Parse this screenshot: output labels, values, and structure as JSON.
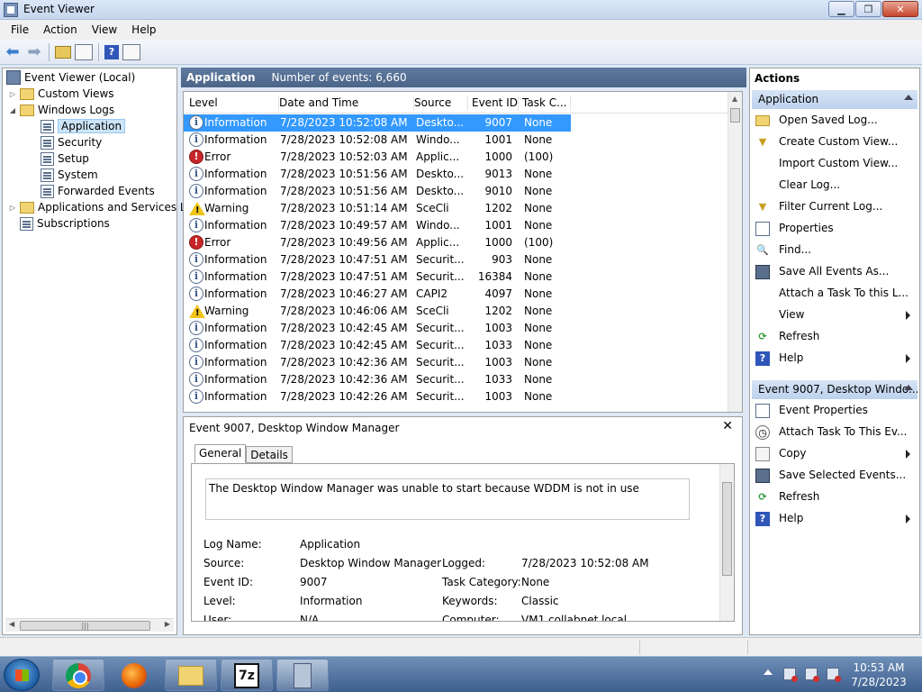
{
  "window": {
    "title": "Event Viewer"
  },
  "menu": [
    "File",
    "Action",
    "View",
    "Help"
  ],
  "tree": {
    "root": "Event Viewer (Local)",
    "custom_views": "Custom Views",
    "windows_logs": "Windows Logs",
    "logs": [
      "Application",
      "Security",
      "Setup",
      "System",
      "Forwarded Events"
    ],
    "apps_services": "Applications and Services Lo",
    "subscriptions": "Subscriptions"
  },
  "center": {
    "title": "Application",
    "count": "Number of events: 6,660"
  },
  "columns": [
    "Level",
    "Date and Time",
    "Source",
    "Event ID",
    "Task C..."
  ],
  "events": [
    {
      "level": "Information",
      "icon": "information",
      "date": "7/28/2023 10:52:08 AM",
      "source": "Deskto...",
      "id": "9007",
      "task": "None"
    },
    {
      "level": "Information",
      "icon": "information",
      "date": "7/28/2023 10:52:08 AM",
      "source": "Windo...",
      "id": "1001",
      "task": "None"
    },
    {
      "level": "Error",
      "icon": "error",
      "date": "7/28/2023 10:52:03 AM",
      "source": "Applic...",
      "id": "1000",
      "task": "(100)"
    },
    {
      "level": "Information",
      "icon": "information",
      "date": "7/28/2023 10:51:56 AM",
      "source": "Deskto...",
      "id": "9013",
      "task": "None"
    },
    {
      "level": "Information",
      "icon": "information",
      "date": "7/28/2023 10:51:56 AM",
      "source": "Deskto...",
      "id": "9010",
      "task": "None"
    },
    {
      "level": "Warning",
      "icon": "warning",
      "date": "7/28/2023 10:51:14 AM",
      "source": "SceCli",
      "id": "1202",
      "task": "None"
    },
    {
      "level": "Information",
      "icon": "information",
      "date": "7/28/2023 10:49:57 AM",
      "source": "Windo...",
      "id": "1001",
      "task": "None"
    },
    {
      "level": "Error",
      "icon": "error",
      "date": "7/28/2023 10:49:56 AM",
      "source": "Applic...",
      "id": "1000",
      "task": "(100)"
    },
    {
      "level": "Information",
      "icon": "information",
      "date": "7/28/2023 10:47:51 AM",
      "source": "Securit...",
      "id": "903",
      "task": "None"
    },
    {
      "level": "Information",
      "icon": "information",
      "date": "7/28/2023 10:47:51 AM",
      "source": "Securit...",
      "id": "16384",
      "task": "None"
    },
    {
      "level": "Information",
      "icon": "information",
      "date": "7/28/2023 10:46:27 AM",
      "source": "CAPI2",
      "id": "4097",
      "task": "None"
    },
    {
      "level": "Warning",
      "icon": "warning",
      "date": "7/28/2023 10:46:06 AM",
      "source": "SceCli",
      "id": "1202",
      "task": "None"
    },
    {
      "level": "Information",
      "icon": "information",
      "date": "7/28/2023 10:42:45 AM",
      "source": "Securit...",
      "id": "1003",
      "task": "None"
    },
    {
      "level": "Information",
      "icon": "information",
      "date": "7/28/2023 10:42:45 AM",
      "source": "Securit...",
      "id": "1033",
      "task": "None"
    },
    {
      "level": "Information",
      "icon": "information",
      "date": "7/28/2023 10:42:36 AM",
      "source": "Securit...",
      "id": "1003",
      "task": "None"
    },
    {
      "level": "Information",
      "icon": "information",
      "date": "7/28/2023 10:42:36 AM",
      "source": "Securit...",
      "id": "1033",
      "task": "None"
    },
    {
      "level": "Information",
      "icon": "information",
      "date": "7/28/2023 10:42:26 AM",
      "source": "Securit...",
      "id": "1003",
      "task": "None"
    }
  ],
  "detail": {
    "title": "Event 9007, Desktop Window Manager",
    "tabs": [
      "General",
      "Details"
    ],
    "message": "The Desktop Window Manager was unable to start because WDDM is not in use",
    "fields": {
      "log_name_label": "Log Name:",
      "log_name": "Application",
      "source_label": "Source:",
      "source": "Desktop Window Manager",
      "logged_label": "Logged:",
      "logged": "7/28/2023 10:52:08 AM",
      "event_id_label": "Event ID:",
      "event_id": "9007",
      "task_cat_label": "Task Category:",
      "task_cat": "None",
      "level_label": "Level:",
      "level": "Information",
      "keywords_label": "Keywords:",
      "keywords": "Classic",
      "user_label": "User:",
      "user": "N/A",
      "computer_label": "Computer:",
      "computer": "VM1.collabnet.local"
    }
  },
  "actions": {
    "header": "Actions",
    "section1": "Application",
    "items1": [
      {
        "label": "Open Saved Log...",
        "icon": "folder"
      },
      {
        "label": "Create Custom View...",
        "icon": "funnel"
      },
      {
        "label": "Import Custom View...",
        "icon": "none"
      },
      {
        "label": "Clear Log...",
        "icon": "none"
      },
      {
        "label": "Filter Current Log...",
        "icon": "funnel"
      },
      {
        "label": "Properties",
        "icon": "props"
      },
      {
        "label": "Find...",
        "icon": "find"
      },
      {
        "label": "Save All Events As...",
        "icon": "save"
      },
      {
        "label": "Attach a Task To this L...",
        "icon": "none"
      },
      {
        "label": "View",
        "icon": "none",
        "sub": true
      },
      {
        "label": "Refresh",
        "icon": "refresh"
      },
      {
        "label": "Help",
        "icon": "help",
        "sub": true
      }
    ],
    "section2": "Event 9007, Desktop Windo...",
    "items2": [
      {
        "label": "Event Properties",
        "icon": "props"
      },
      {
        "label": "Attach Task To This Ev...",
        "icon": "task"
      },
      {
        "label": "Copy",
        "icon": "copy",
        "sub": true
      },
      {
        "label": "Save Selected Events...",
        "icon": "save"
      },
      {
        "label": "Refresh",
        "icon": "refresh"
      },
      {
        "label": "Help",
        "icon": "help",
        "sub": true
      }
    ]
  },
  "taskbar": {
    "apps": [
      "chrome",
      "firefox",
      "explorer",
      "7z",
      "event-viewer"
    ],
    "sevenz_label": "7z",
    "time": "10:53 AM",
    "date": "7/28/2023"
  }
}
